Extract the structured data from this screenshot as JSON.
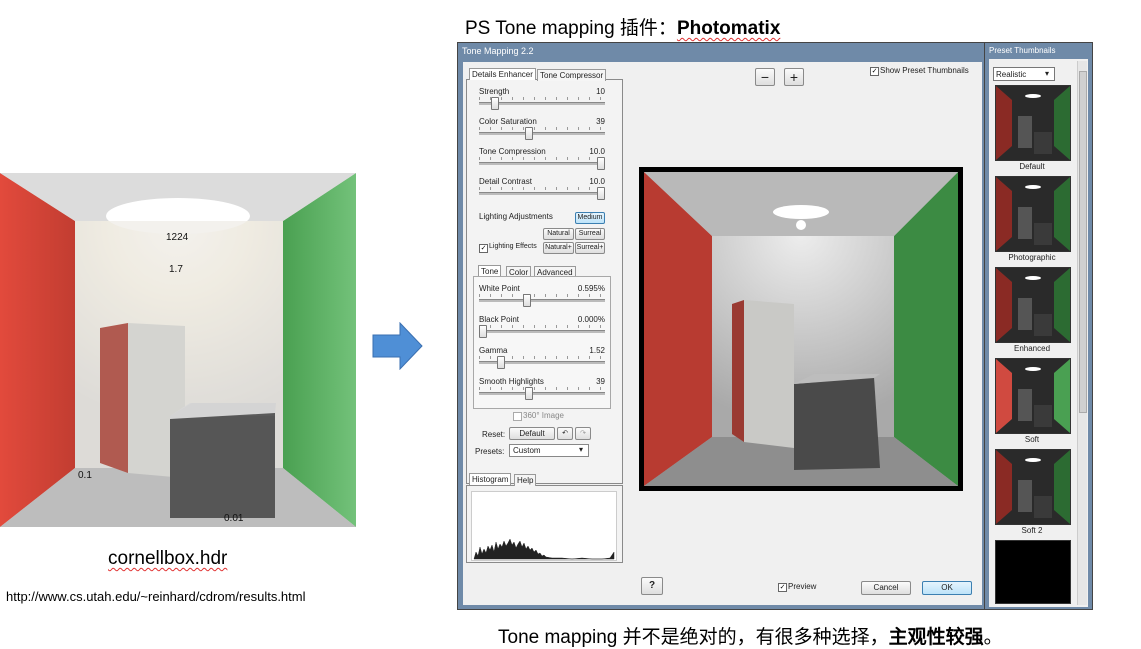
{
  "slide": {
    "title_prefix": "PS Tone mapping 插件：",
    "title_bold": "Photomatix",
    "file_caption": "cornellbox.hdr",
    "url_caption": "http://www.cs.utah.edu/~reinhard/cdrom/results.html",
    "bottom_caption_prefix": "Tone mapping 并不是绝对的，有很多种选择，",
    "bottom_caption_bold": "主观性较强",
    "bottom_caption_suffix": "。"
  },
  "render_annotations": {
    "a1": "1224",
    "a2": "1.7",
    "a3": "0.1",
    "a4": "0.01"
  },
  "window": {
    "title": "Tone Mapping 2.2",
    "top_tabs": [
      "Details Enhancer",
      "Tone Compressor"
    ],
    "sliders_top": [
      {
        "label": "Strength",
        "value": "10",
        "pos": 0.1
      },
      {
        "label": "Color Saturation",
        "value": "39",
        "pos": 0.39
      },
      {
        "label": "Tone Compression",
        "value": "10.0",
        "pos": 1.0
      },
      {
        "label": "Detail Contrast",
        "value": "10.0",
        "pos": 1.0
      }
    ],
    "lighting": {
      "label": "Lighting Adjustments",
      "medium": "Medium",
      "natural": "Natural",
      "surreal": "Surreal",
      "natural_plus": "Natural+",
      "surreal_plus": "Surreal+",
      "effects_label": "Lighting Effects"
    },
    "sub_tabs": [
      "Tone",
      "Color",
      "Advanced"
    ],
    "sliders_bottom": [
      {
        "label": "White Point",
        "value": "0.595%",
        "pos": 0.37
      },
      {
        "label": "Black Point",
        "value": "0.000%",
        "pos": 0.0
      },
      {
        "label": "Gamma",
        "value": "1.52",
        "pos": 0.15
      },
      {
        "label": "Smooth Highlights",
        "value": "39",
        "pos": 0.39
      }
    ],
    "image360_label": "360° Image",
    "reset_label": "Reset:",
    "default_button": "Default",
    "presets_label": "Presets:",
    "presets_value": "Custom",
    "hist_tabs": [
      "Histogram",
      "Help"
    ],
    "show_thumbs_label": "Show Preset Thumbnails",
    "zoom_out": "−",
    "zoom_in": "+",
    "help_button": "?",
    "preview_label": "Preview",
    "cancel_button": "Cancel",
    "ok_button": "OK"
  },
  "thumbs_panel": {
    "title": "Preset Thumbnails",
    "dropdown_value": "Realistic",
    "items": [
      "Default",
      "Photographic",
      "Enhanced",
      "Soft",
      "Soft 2"
    ]
  },
  "colors": {
    "accent": "#3c7fb1",
    "arrow": "#4f8fd6",
    "red_wall": "#d9463a",
    "green_wall": "#3f9a48"
  }
}
